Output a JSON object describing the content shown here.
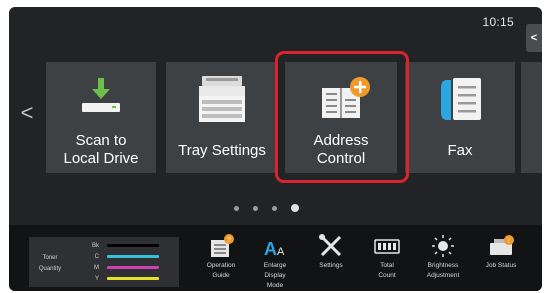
{
  "status": {
    "time": "10:15",
    "side_tab_glyph": "<"
  },
  "nav": {
    "prev_glyph": "<"
  },
  "tiles": [
    {
      "label_line1": "Scan to",
      "label_line2": "Local Drive",
      "icon": "scan-to-drive-icon"
    },
    {
      "label_line1": "Tray Settings",
      "icon": "printer-tray-icon"
    },
    {
      "label_line1": "Address",
      "label_line2": "Control",
      "icon": "address-book-add-icon"
    },
    {
      "label_line1": "Fax",
      "icon": "fax-icon"
    }
  ],
  "pager": {
    "pages": 4,
    "active_index": 3
  },
  "toner": {
    "label_line1": "Toner",
    "label_line2": "Quantity",
    "rows": [
      {
        "key": "Bk",
        "color": "#000000"
      },
      {
        "key": "C",
        "color": "#33c3d8"
      },
      {
        "key": "M",
        "color": "#cf3fb5"
      },
      {
        "key": "Y",
        "color": "#e8e02a"
      }
    ]
  },
  "functions": [
    {
      "label": "Operation\nGuide",
      "icon": "operation-guide-icon"
    },
    {
      "label": "Enlarge\nDisplay\nMode",
      "icon": "enlarge-display-icon"
    },
    {
      "label": "Settings",
      "icon": "settings-tools-icon"
    },
    {
      "label": "Total\nCount",
      "icon": "counter-icon"
    },
    {
      "label": "Brightness\nAdjustment",
      "icon": "brightness-icon"
    },
    {
      "label": "Job Status",
      "icon": "job-status-icon"
    }
  ],
  "colors": {
    "highlight": "#d9232f",
    "tile_bg": "#3e4144",
    "screen_bg": "#212325",
    "accent_orange": "#f19a2a",
    "scan_green": "#6cc04a",
    "fax_blue": "#2aa7e0"
  }
}
